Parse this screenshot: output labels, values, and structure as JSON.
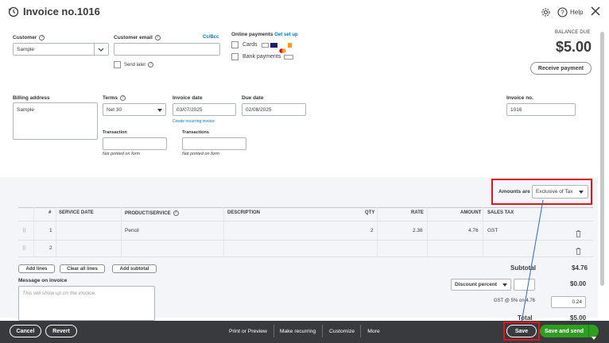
{
  "header": {
    "title": "Invoice no.1016",
    "help_label": "Help"
  },
  "customer": {
    "label": "Customer",
    "value": "Sample",
    "email_label": "Customer email",
    "cc_bcc": "Cc/Bcc",
    "send_later": "Send later"
  },
  "online_payments": {
    "label": "Online payments",
    "get_set_up": "Get set up",
    "cards": "Cards",
    "bank_payments": "Bank payments"
  },
  "balance": {
    "label": "BALANCE DUE",
    "amount": "$5.00",
    "receive_payment": "Receive payment"
  },
  "billing": {
    "label": "Billing address",
    "value": "Sample"
  },
  "terms": {
    "label": "Terms",
    "value": "Net 30"
  },
  "invoice_date": {
    "label": "Invoice date",
    "value": "03/07/2025",
    "recurring_link": "Create recurring invoice"
  },
  "due_date": {
    "label": "Due date",
    "value": "02/08/2025"
  },
  "invoice_no": {
    "label": "Invoice no.",
    "value": "1016"
  },
  "transaction1": {
    "label": "Transaction",
    "note": "Not printed on form"
  },
  "transaction2": {
    "label": "Transactions",
    "note": "Not printed on form"
  },
  "amounts": {
    "label": "Amounts are",
    "value": "Exclusive of Tax"
  },
  "table": {
    "headers": [
      "#",
      "SERVICE DATE",
      "PRODUCT/SERVICE",
      "DESCRIPTION",
      "QTY",
      "RATE",
      "AMOUNT",
      "SALES TAX"
    ],
    "rows": [
      {
        "num": "1",
        "date": "",
        "product": "Pencil",
        "description": "",
        "qty": "2",
        "rate": "2.38",
        "amount": "4.76",
        "tax": "GST"
      },
      {
        "num": "2",
        "date": "",
        "product": "",
        "description": "",
        "qty": "",
        "rate": "",
        "amount": "",
        "tax": ""
      }
    ]
  },
  "line_buttons": {
    "add_lines": "Add lines",
    "clear_all": "Clear all lines",
    "add_subtotal": "Add subtotal"
  },
  "message": {
    "label": "Message on invoice",
    "placeholder": "This will show up on the invoice."
  },
  "totals": {
    "subtotal_label": "Subtotal",
    "subtotal_value": "$4.76",
    "discount_label": "Discount percent",
    "discount_value": "$0.00",
    "gst_label": "GST @ 5% on 4.76",
    "gst_value": "0.24",
    "total_label": "Total",
    "total_value": "$5.00"
  },
  "footer": {
    "cancel": "Cancel",
    "revert": "Revert",
    "print_preview": "Print or Preview",
    "make_recurring": "Make recurring",
    "customize": "Customize",
    "more": "More",
    "save": "Save",
    "save_and_send": "Save and send"
  }
}
